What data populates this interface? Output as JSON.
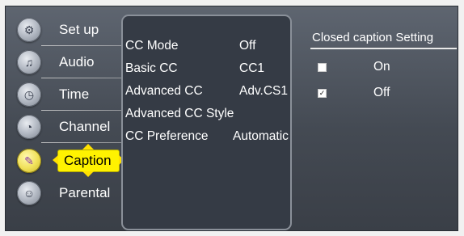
{
  "menu": {
    "items": [
      {
        "label": "Set up",
        "icon": "gear-icon",
        "selected": false
      },
      {
        "label": "Audio",
        "icon": "speaker-icon",
        "selected": false
      },
      {
        "label": "Time",
        "icon": "clock-icon",
        "selected": false
      },
      {
        "label": "Channel",
        "icon": "satellite-dish-icon",
        "selected": false
      },
      {
        "label": "Caption",
        "icon": "caption-icon",
        "selected": true
      },
      {
        "label": "Parental",
        "icon": "parental-lock-icon",
        "selected": false
      }
    ]
  },
  "settings": {
    "rows": [
      {
        "name": "CC Mode",
        "value": "Off"
      },
      {
        "name": "Basic CC",
        "value": "CC1"
      },
      {
        "name": "Advanced CC",
        "value": "Adv.CS1"
      },
      {
        "name": "Advanced CC Style",
        "value": ""
      },
      {
        "name": "CC Preference",
        "value": "Automatic"
      }
    ]
  },
  "closed_caption": {
    "title": "Closed caption Setting",
    "options": [
      {
        "label": "On",
        "checked": false
      },
      {
        "label": "Off",
        "checked": true
      }
    ]
  },
  "colors": {
    "highlight": "#fff200",
    "panel_background": "#353b45",
    "screen_background": "#4d535c"
  }
}
